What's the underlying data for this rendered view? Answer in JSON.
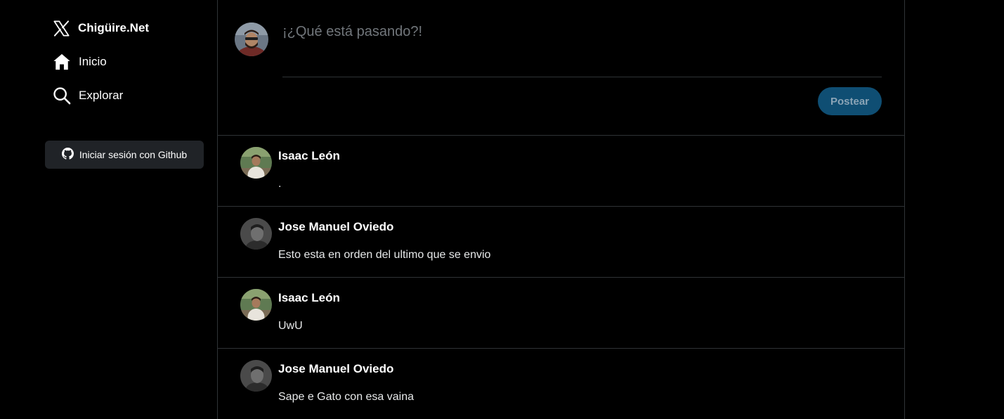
{
  "sidebar": {
    "brand_label": "Chigüire.Net",
    "brand_icon": "x-logo-icon",
    "items": [
      {
        "label": "Inicio",
        "icon": "home-icon"
      },
      {
        "label": "Explorar",
        "icon": "search-icon"
      }
    ],
    "login_button": {
      "label": "Iniciar sesión con Github",
      "icon": "github-icon"
    }
  },
  "composer": {
    "placeholder": "¡¿Qué está pasando?!",
    "submit_label": "Postear",
    "submit_color": "#0f4e73"
  },
  "feed": {
    "posts": [
      {
        "author": "Isaac León",
        "text": "."
      },
      {
        "author": "Jose Manuel Oviedo",
        "text": "Esto esta en orden del ultimo que se envio"
      },
      {
        "author": "Isaac León",
        "text": "UwU"
      },
      {
        "author": "Jose Manuel Oviedo",
        "text": "Sape e Gato con esa vaina"
      }
    ]
  },
  "colors": {
    "background": "#000000",
    "border": "#2f3336",
    "text": "#e7e9ea",
    "muted": "#71767b",
    "button_dark": "#202327"
  }
}
